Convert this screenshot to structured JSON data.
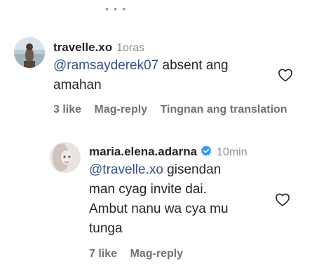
{
  "comment1": {
    "username": "travelle.xo",
    "time": "1oras",
    "mention": "@ramsayderek07",
    "text_rest": " absent ang",
    "text_line2": "amahan",
    "likes": "3 like",
    "reply_label": "Mag-reply",
    "translate_label": "Tingnan ang translation"
  },
  "comment2": {
    "username": "maria.elena.adarna",
    "time": "10min",
    "mention": "@travelle.xo",
    "text_rest": " gisendan",
    "text_line2": "man cyag invite dai.",
    "text_line3": "Ambut nanu wa cya mu",
    "text_line4": "tunga",
    "likes": "7 like",
    "reply_label": "Mag-reply"
  },
  "colors": {
    "mention": "#385185",
    "verified": "#3897f0",
    "muted": "#8e8e8e"
  },
  "icons": {
    "like": "heart-outline-icon",
    "verified": "verified-badge-icon"
  }
}
